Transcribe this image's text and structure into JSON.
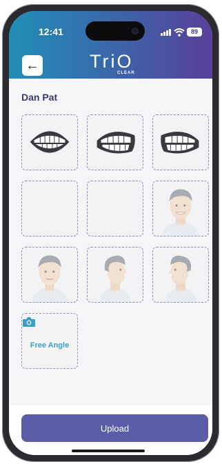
{
  "status_bar": {
    "time": "12:41",
    "battery": "89"
  },
  "header": {
    "logo_word": "TriO",
    "logo_sub": "CLEAR"
  },
  "patient": {
    "name": "Dan Pat"
  },
  "photo_slots": [
    {
      "icon": "teeth-front-icon"
    },
    {
      "icon": "teeth-right-icon"
    },
    {
      "icon": "teeth-left-icon"
    },
    {
      "icon": "empty"
    },
    {
      "icon": "empty"
    },
    {
      "icon": "face-smile-icon"
    },
    {
      "icon": "face-front-icon"
    },
    {
      "icon": "face-profile-right-icon"
    },
    {
      "icon": "face-profile-left-icon"
    }
  ],
  "free_angle": {
    "label": "Free Angle",
    "icon": "camera-icon"
  },
  "footer": {
    "upload_label": "Upload"
  },
  "colors": {
    "header_start": "#1f8fb7",
    "header_end": "#5a3f9a",
    "button": "#5b5da8",
    "accent": "#3aa0c4"
  }
}
